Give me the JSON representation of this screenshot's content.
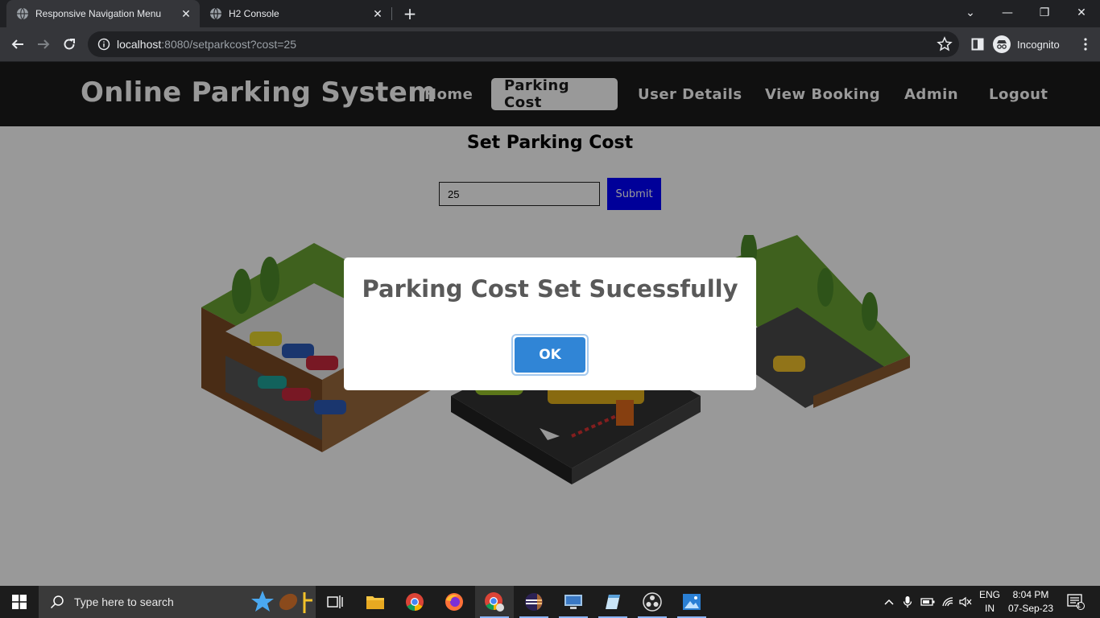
{
  "browser": {
    "tabs": [
      {
        "title": "Responsive Navigation Menu",
        "active": true
      },
      {
        "title": "H2 Console",
        "active": false
      }
    ],
    "new_tab_label": "+",
    "url_host": "localhost",
    "url_rest": ":8080/setparkcost?cost=25",
    "profile_label": "Incognito"
  },
  "site": {
    "brand": "Online Parking System",
    "nav": [
      "Home",
      "Parking Cost",
      "User Details",
      "View Booking",
      "Admin",
      "Logout"
    ],
    "active_nav": "Parking Cost"
  },
  "form": {
    "title": "Set Parking Cost",
    "cost_value": "25",
    "submit_label": "Submit"
  },
  "dialog": {
    "message": "Parking Cost Set Sucessfully",
    "ok_label": "OK"
  },
  "taskbar": {
    "search_placeholder": "Type here to search",
    "lang_line1": "ENG",
    "lang_line2": "IN",
    "time": "8:04 PM",
    "date": "07-Sep-23",
    "notification_count": "1"
  },
  "colors": {
    "navbar": "#1b1b1b",
    "submit": "#0000ff",
    "ok_button": "#3085d6",
    "dialog_text": "#595959"
  }
}
